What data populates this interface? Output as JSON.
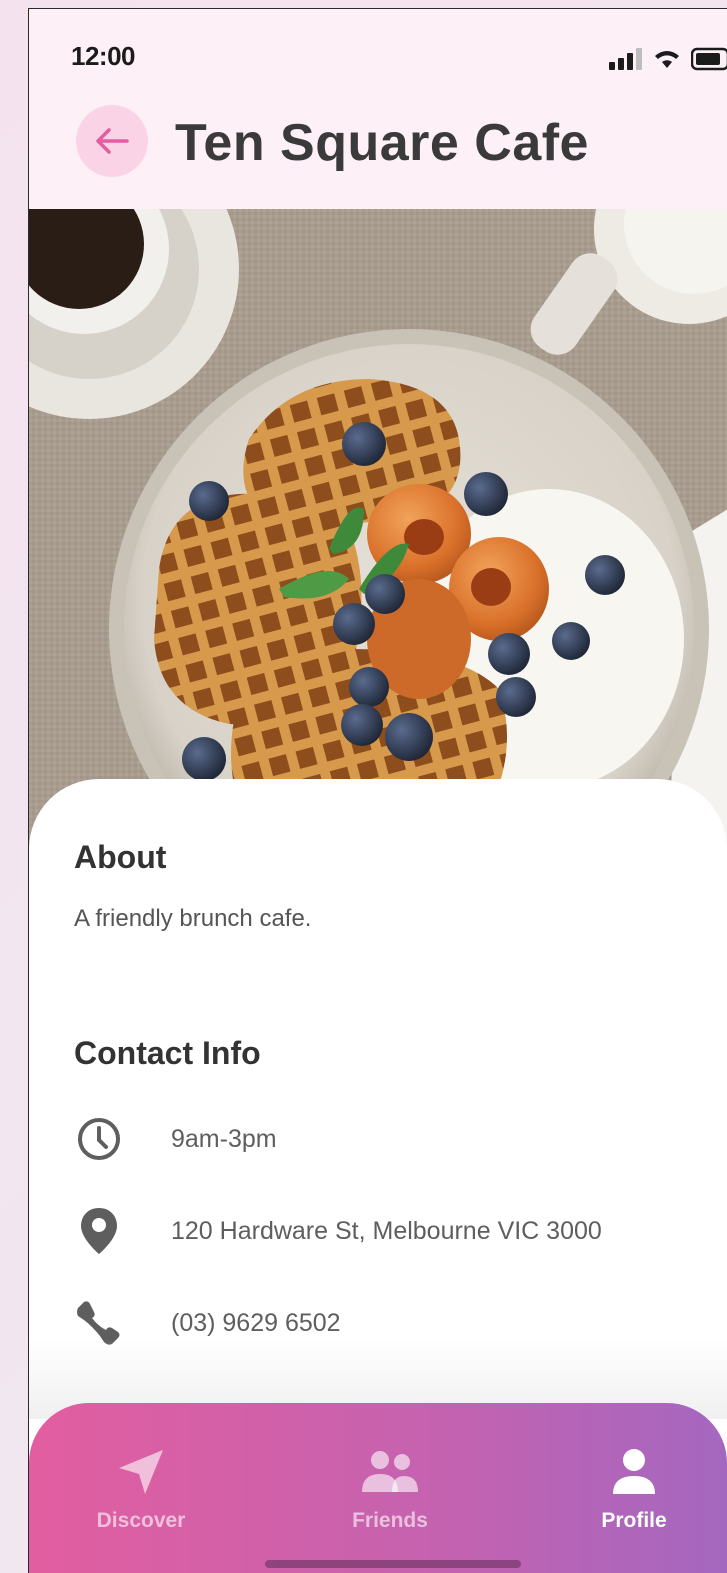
{
  "status_bar": {
    "time": "12:00"
  },
  "header": {
    "title": "Ten Square Cafe"
  },
  "about": {
    "heading": "About",
    "text": "A friendly brunch cafe."
  },
  "contact": {
    "heading": "Contact Info",
    "hours": "9am-3pm",
    "address": "120 Hardware St, Melbourne VIC 3000",
    "phone": "(03) 9629 6502"
  },
  "tabs": [
    {
      "label": "Discover",
      "icon": "navigation-arrow-icon",
      "active": false
    },
    {
      "label": "Friends",
      "icon": "people-icon",
      "active": false
    },
    {
      "label": "Profile",
      "icon": "person-icon",
      "active": true
    }
  ],
  "colors": {
    "accent_pink": "#e25ea0",
    "accent_purple": "#a467c0",
    "header_bg": "#fdf0f6",
    "back_button_bg": "#fbd3e6"
  }
}
